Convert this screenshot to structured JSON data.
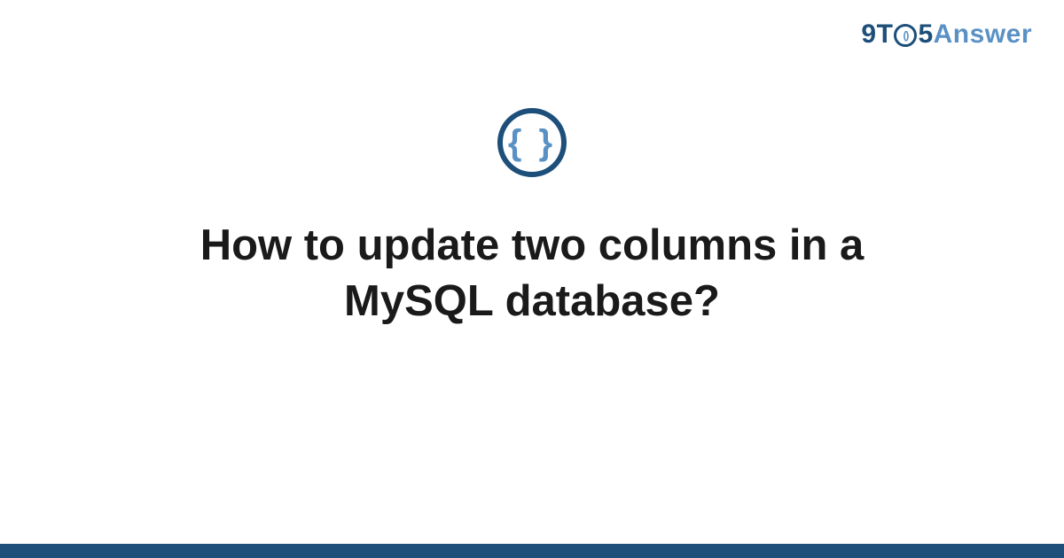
{
  "logo": {
    "part1": "9T",
    "inner": "()",
    "part2": "5",
    "part3": "Answer"
  },
  "icon": {
    "glyph": "{ }"
  },
  "title": "How to update two columns in a MySQL database?",
  "colors": {
    "primary": "#1d4f7a",
    "accent": "#5a91c5"
  }
}
